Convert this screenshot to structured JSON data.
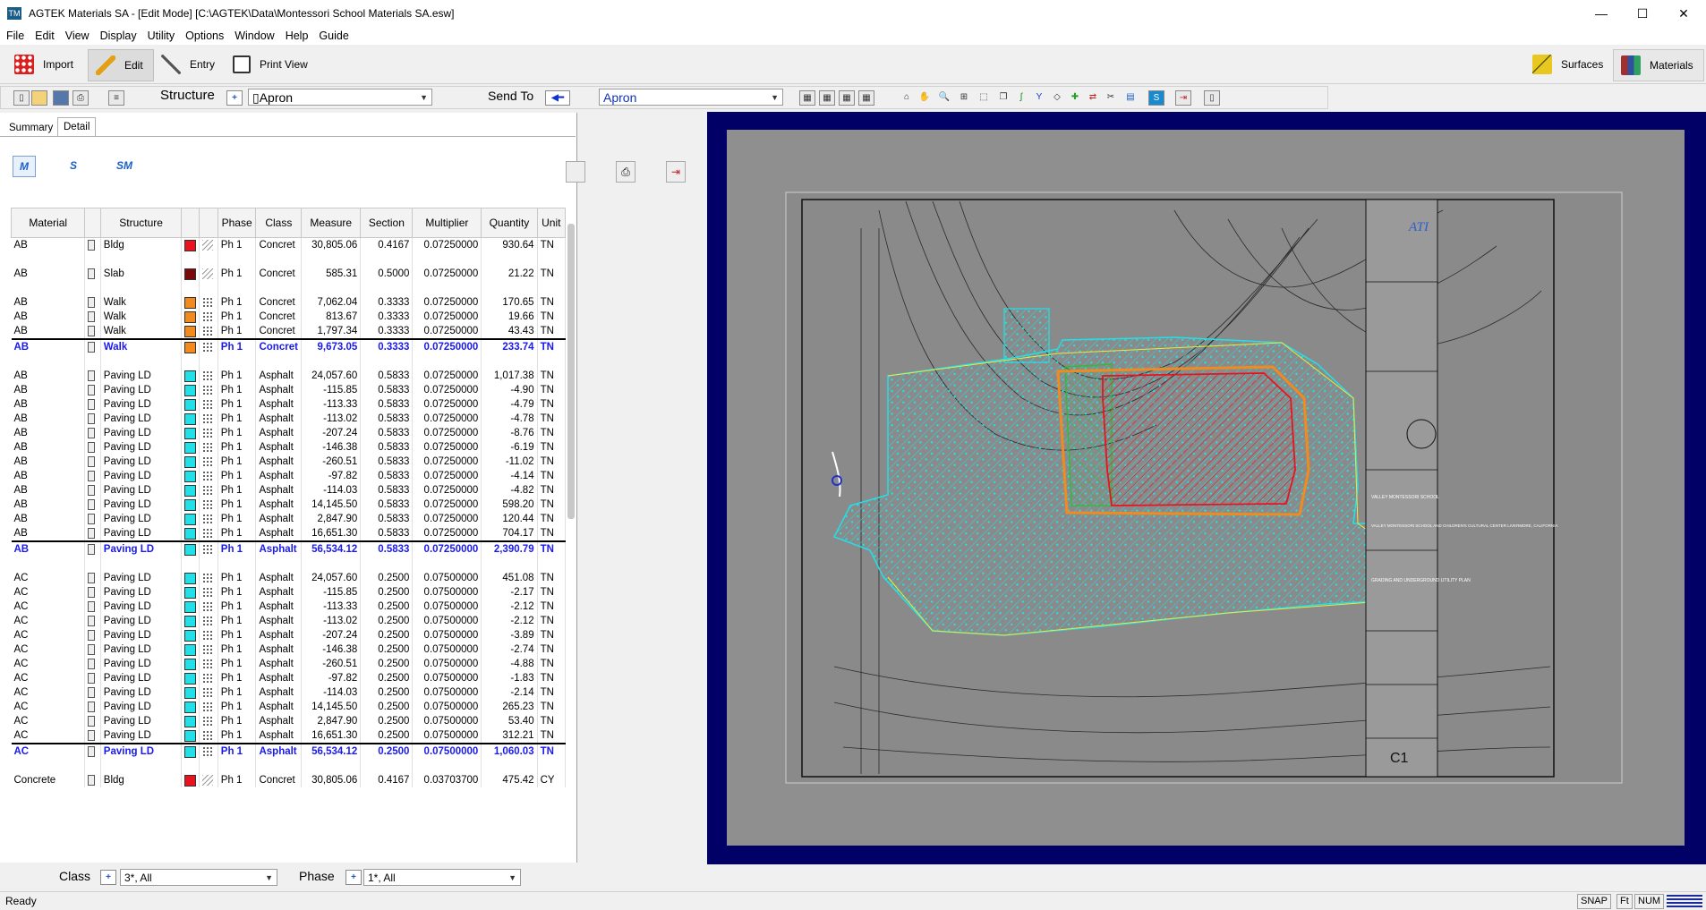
{
  "window": {
    "title": "AGTEK Materials SA - [Edit Mode]  [C:\\AGTEK\\Data\\Montessori School Materials SA.esw]",
    "app_icon": "TM",
    "controls": [
      "—",
      "☐",
      "✕"
    ]
  },
  "menu": [
    "File",
    "Edit",
    "View",
    "Display",
    "Utility",
    "Options",
    "Window",
    "Help",
    "Guide"
  ],
  "main_toolbar": {
    "import": "Import",
    "edit": "Edit",
    "entry": "Entry",
    "print_view": "Print View",
    "surfaces": "Surfaces",
    "materials": "Materials"
  },
  "toolbar2": {
    "structure_label": "Structure",
    "structure_value": "▯Apron",
    "send_to_label": "Send To",
    "send_to_value": "Apron"
  },
  "tabs": [
    "Summary",
    "Detail"
  ],
  "mode_buttons": [
    "M",
    "S",
    "SM"
  ],
  "grid": {
    "columns": [
      "Material",
      "",
      "Structure",
      "",
      "",
      "Phase",
      "Class",
      "Measure",
      "Section",
      "Multiplier",
      "Quantity",
      "Unit"
    ],
    "rows": [
      {
        "t": "n",
        "m": "AB",
        "s": "Bldg",
        "c": "#e8131e",
        "p": "dots0",
        "ph": "Ph 1",
        "cl": "Concret",
        "me": "30,805.06",
        "se": "0.4167",
        "mu": "0.07250000",
        "q": "930.64",
        "u": "TN"
      },
      {
        "t": "b"
      },
      {
        "t": "n",
        "m": "AB",
        "s": "Slab",
        "c": "#7a0a0a",
        "p": "dots0",
        "ph": "Ph 1",
        "cl": "Concret",
        "me": "585.31",
        "se": "0.5000",
        "mu": "0.07250000",
        "q": "21.22",
        "u": "TN"
      },
      {
        "t": "b"
      },
      {
        "t": "n",
        "m": "AB",
        "s": "Walk",
        "c": "#f28a1e",
        "p": "dots",
        "ph": "Ph 1",
        "cl": "Concret",
        "me": "7,062.04",
        "se": "0.3333",
        "mu": "0.07250000",
        "q": "170.65",
        "u": "TN"
      },
      {
        "t": "n",
        "m": "AB",
        "s": "Walk",
        "c": "#f28a1e",
        "p": "dots",
        "ph": "Ph 1",
        "cl": "Concret",
        "me": "813.67",
        "se": "0.3333",
        "mu": "0.07250000",
        "q": "19.66",
        "u": "TN"
      },
      {
        "t": "n",
        "m": "AB",
        "s": "Walk",
        "c": "#f28a1e",
        "p": "dots",
        "ph": "Ph 1",
        "cl": "Concret",
        "me": "1,797.34",
        "se": "0.3333",
        "mu": "0.07250000",
        "q": "43.43",
        "u": "TN"
      },
      {
        "t": "t",
        "m": "AB",
        "s": "Walk",
        "c": "#f28a1e",
        "p": "dots",
        "ph": "Ph 1",
        "cl": "Concret",
        "me": "9,673.05",
        "se": "0.3333",
        "mu": "0.07250000",
        "q": "233.74",
        "u": "TN"
      },
      {
        "t": "b"
      },
      {
        "t": "n",
        "m": "AB",
        "s": "Paving LD",
        "c": "#22e0e8",
        "p": "dots",
        "ph": "Ph 1",
        "cl": "Asphalt",
        "me": "24,057.60",
        "se": "0.5833",
        "mu": "0.07250000",
        "q": "1,017.38",
        "u": "TN"
      },
      {
        "t": "n",
        "m": "AB",
        "s": "Paving LD",
        "c": "#22e0e8",
        "p": "dots",
        "ph": "Ph 1",
        "cl": "Asphalt",
        "me": "-115.85",
        "se": "0.5833",
        "mu": "0.07250000",
        "q": "-4.90",
        "u": "TN"
      },
      {
        "t": "n",
        "m": "AB",
        "s": "Paving LD",
        "c": "#22e0e8",
        "p": "dots",
        "ph": "Ph 1",
        "cl": "Asphalt",
        "me": "-113.33",
        "se": "0.5833",
        "mu": "0.07250000",
        "q": "-4.79",
        "u": "TN"
      },
      {
        "t": "n",
        "m": "AB",
        "s": "Paving LD",
        "c": "#22e0e8",
        "p": "dots",
        "ph": "Ph 1",
        "cl": "Asphalt",
        "me": "-113.02",
        "se": "0.5833",
        "mu": "0.07250000",
        "q": "-4.78",
        "u": "TN"
      },
      {
        "t": "n",
        "m": "AB",
        "s": "Paving LD",
        "c": "#22e0e8",
        "p": "dots",
        "ph": "Ph 1",
        "cl": "Asphalt",
        "me": "-207.24",
        "se": "0.5833",
        "mu": "0.07250000",
        "q": "-8.76",
        "u": "TN"
      },
      {
        "t": "n",
        "m": "AB",
        "s": "Paving LD",
        "c": "#22e0e8",
        "p": "dots",
        "ph": "Ph 1",
        "cl": "Asphalt",
        "me": "-146.38",
        "se": "0.5833",
        "mu": "0.07250000",
        "q": "-6.19",
        "u": "TN"
      },
      {
        "t": "n",
        "m": "AB",
        "s": "Paving LD",
        "c": "#22e0e8",
        "p": "dots",
        "ph": "Ph 1",
        "cl": "Asphalt",
        "me": "-260.51",
        "se": "0.5833",
        "mu": "0.07250000",
        "q": "-11.02",
        "u": "TN"
      },
      {
        "t": "n",
        "m": "AB",
        "s": "Paving LD",
        "c": "#22e0e8",
        "p": "dots",
        "ph": "Ph 1",
        "cl": "Asphalt",
        "me": "-97.82",
        "se": "0.5833",
        "mu": "0.07250000",
        "q": "-4.14",
        "u": "TN"
      },
      {
        "t": "n",
        "m": "AB",
        "s": "Paving LD",
        "c": "#22e0e8",
        "p": "dots",
        "ph": "Ph 1",
        "cl": "Asphalt",
        "me": "-114.03",
        "se": "0.5833",
        "mu": "0.07250000",
        "q": "-4.82",
        "u": "TN"
      },
      {
        "t": "n",
        "m": "AB",
        "s": "Paving LD",
        "c": "#22e0e8",
        "p": "dots",
        "ph": "Ph 1",
        "cl": "Asphalt",
        "me": "14,145.50",
        "se": "0.5833",
        "mu": "0.07250000",
        "q": "598.20",
        "u": "TN"
      },
      {
        "t": "n",
        "m": "AB",
        "s": "Paving LD",
        "c": "#22e0e8",
        "p": "dots",
        "ph": "Ph 1",
        "cl": "Asphalt",
        "me": "2,847.90",
        "se": "0.5833",
        "mu": "0.07250000",
        "q": "120.44",
        "u": "TN"
      },
      {
        "t": "n",
        "m": "AB",
        "s": "Paving LD",
        "c": "#22e0e8",
        "p": "dots",
        "ph": "Ph 1",
        "cl": "Asphalt",
        "me": "16,651.30",
        "se": "0.5833",
        "mu": "0.07250000",
        "q": "704.17",
        "u": "TN"
      },
      {
        "t": "t",
        "m": "AB",
        "s": "Paving LD",
        "c": "#22e0e8",
        "p": "dots",
        "ph": "Ph 1",
        "cl": "Asphalt",
        "me": "56,534.12",
        "se": "0.5833",
        "mu": "0.07250000",
        "q": "2,390.79",
        "u": "TN"
      },
      {
        "t": "b"
      },
      {
        "t": "n",
        "m": "AC",
        "s": "Paving LD",
        "c": "#22e0e8",
        "p": "dots",
        "ph": "Ph 1",
        "cl": "Asphalt",
        "me": "24,057.60",
        "se": "0.2500",
        "mu": "0.07500000",
        "q": "451.08",
        "u": "TN"
      },
      {
        "t": "n",
        "m": "AC",
        "s": "Paving LD",
        "c": "#22e0e8",
        "p": "dots",
        "ph": "Ph 1",
        "cl": "Asphalt",
        "me": "-115.85",
        "se": "0.2500",
        "mu": "0.07500000",
        "q": "-2.17",
        "u": "TN"
      },
      {
        "t": "n",
        "m": "AC",
        "s": "Paving LD",
        "c": "#22e0e8",
        "p": "dots",
        "ph": "Ph 1",
        "cl": "Asphalt",
        "me": "-113.33",
        "se": "0.2500",
        "mu": "0.07500000",
        "q": "-2.12",
        "u": "TN"
      },
      {
        "t": "n",
        "m": "AC",
        "s": "Paving LD",
        "c": "#22e0e8",
        "p": "dots",
        "ph": "Ph 1",
        "cl": "Asphalt",
        "me": "-113.02",
        "se": "0.2500",
        "mu": "0.07500000",
        "q": "-2.12",
        "u": "TN"
      },
      {
        "t": "n",
        "m": "AC",
        "s": "Paving LD",
        "c": "#22e0e8",
        "p": "dots",
        "ph": "Ph 1",
        "cl": "Asphalt",
        "me": "-207.24",
        "se": "0.2500",
        "mu": "0.07500000",
        "q": "-3.89",
        "u": "TN"
      },
      {
        "t": "n",
        "m": "AC",
        "s": "Paving LD",
        "c": "#22e0e8",
        "p": "dots",
        "ph": "Ph 1",
        "cl": "Asphalt",
        "me": "-146.38",
        "se": "0.2500",
        "mu": "0.07500000",
        "q": "-2.74",
        "u": "TN"
      },
      {
        "t": "n",
        "m": "AC",
        "s": "Paving LD",
        "c": "#22e0e8",
        "p": "dots",
        "ph": "Ph 1",
        "cl": "Asphalt",
        "me": "-260.51",
        "se": "0.2500",
        "mu": "0.07500000",
        "q": "-4.88",
        "u": "TN"
      },
      {
        "t": "n",
        "m": "AC",
        "s": "Paving LD",
        "c": "#22e0e8",
        "p": "dots",
        "ph": "Ph 1",
        "cl": "Asphalt",
        "me": "-97.82",
        "se": "0.2500",
        "mu": "0.07500000",
        "q": "-1.83",
        "u": "TN"
      },
      {
        "t": "n",
        "m": "AC",
        "s": "Paving LD",
        "c": "#22e0e8",
        "p": "dots",
        "ph": "Ph 1",
        "cl": "Asphalt",
        "me": "-114.03",
        "se": "0.2500",
        "mu": "0.07500000",
        "q": "-2.14",
        "u": "TN"
      },
      {
        "t": "n",
        "m": "AC",
        "s": "Paving LD",
        "c": "#22e0e8",
        "p": "dots",
        "ph": "Ph 1",
        "cl": "Asphalt",
        "me": "14,145.50",
        "se": "0.2500",
        "mu": "0.07500000",
        "q": "265.23",
        "u": "TN"
      },
      {
        "t": "n",
        "m": "AC",
        "s": "Paving LD",
        "c": "#22e0e8",
        "p": "dots",
        "ph": "Ph 1",
        "cl": "Asphalt",
        "me": "2,847.90",
        "se": "0.2500",
        "mu": "0.07500000",
        "q": "53.40",
        "u": "TN"
      },
      {
        "t": "n",
        "m": "AC",
        "s": "Paving LD",
        "c": "#22e0e8",
        "p": "dots",
        "ph": "Ph 1",
        "cl": "Asphalt",
        "me": "16,651.30",
        "se": "0.2500",
        "mu": "0.07500000",
        "q": "312.21",
        "u": "TN"
      },
      {
        "t": "t",
        "m": "AC",
        "s": "Paving LD",
        "c": "#22e0e8",
        "p": "dots",
        "ph": "Ph 1",
        "cl": "Asphalt",
        "me": "56,534.12",
        "se": "0.2500",
        "mu": "0.07500000",
        "q": "1,060.03",
        "u": "TN"
      },
      {
        "t": "b"
      },
      {
        "t": "n",
        "m": "Concrete",
        "s": "Bldg",
        "c": "#e8131e",
        "p": "dots0",
        "ph": "Ph 1",
        "cl": "Concret",
        "me": "30,805.06",
        "se": "0.4167",
        "mu": "0.03703700",
        "q": "475.42",
        "u": "CY"
      }
    ]
  },
  "filters": {
    "class_label": "Class",
    "class_value": "3*, All",
    "phase_label": "Phase",
    "phase_value": "1*, All"
  },
  "status": {
    "text": "Ready",
    "snap": "SNAP",
    "units": "Ft",
    "num": "NUM"
  },
  "plan_sheet": {
    "firm": "ATI",
    "school": "VALLEY MONTESSORI SCHOOL",
    "project": "VALLEY MONTESSORI SCHOOL AND CHILDREN'S CULTURAL CENTER LIVERMORE, CALIFORNIA",
    "sheet_title": "GRADING AND UNDERGROUND UTILITY PLAN",
    "sheet_no": "C1"
  },
  "colors": {
    "map_border": "#000066",
    "paving": "#22e0e8",
    "building": "#e8131e",
    "walk": "#f28a1e",
    "landscape": "#27c12b"
  }
}
